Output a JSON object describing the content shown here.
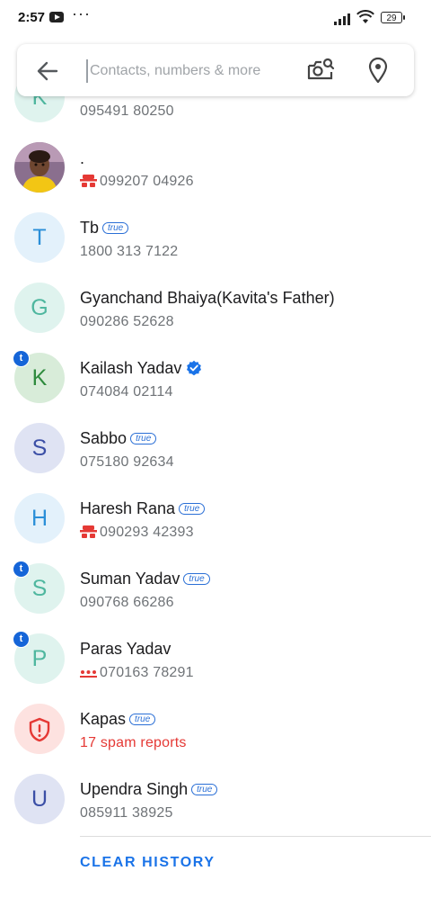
{
  "status_bar": {
    "time": "2:57",
    "battery": "29"
  },
  "search": {
    "placeholder": "Contacts, numbers & more"
  },
  "true_badge_text": "true",
  "contacts": [
    {
      "name": "",
      "number": "095491 80250",
      "avatar_letter": "K",
      "avatar_bg": "#dff3ee",
      "avatar_fg": "#4fb79f"
    },
    {
      "name": ".",
      "number": "099207 04926",
      "avatar_type": "photo",
      "number_icon": "spy-icon"
    },
    {
      "name": "Tb",
      "number": "1800 313 7122",
      "avatar_letter": "T",
      "avatar_bg": "#e3f1fb",
      "avatar_fg": "#2b8fd8",
      "true_badge": true
    },
    {
      "name": "Gyanchand Bhaiya(Kavita's Father)",
      "number": "090286 52628",
      "avatar_letter": "G",
      "avatar_bg": "#dff3ee",
      "avatar_fg": "#4fb79f"
    },
    {
      "name": "Kailash Yadav",
      "number": "074084 02114",
      "avatar_letter": "K",
      "avatar_bg": "#d8ecd9",
      "avatar_fg": "#2e8b3d",
      "verified": true,
      "truecaller_badge": true
    },
    {
      "name": "Sabbo",
      "number": "075180 92634",
      "avatar_letter": "S",
      "avatar_bg": "#dfe3f3",
      "avatar_fg": "#3b4fa6",
      "true_badge": true
    },
    {
      "name": "Haresh Rana",
      "number": "090293 42393",
      "avatar_letter": "H",
      "avatar_bg": "#e3f1fb",
      "avatar_fg": "#2b8fd8",
      "true_badge": true,
      "number_icon": "spy-icon"
    },
    {
      "name": "Suman Yadav",
      "number": "090768 66286",
      "avatar_letter": "S",
      "avatar_bg": "#dff3ee",
      "avatar_fg": "#4fb79f",
      "true_badge": true,
      "truecaller_badge": true
    },
    {
      "name": "Paras Yadav",
      "number": "070163 78291",
      "avatar_letter": "P",
      "avatar_bg": "#dff3ee",
      "avatar_fg": "#4fb79f",
      "truecaller_badge": true,
      "number_icon": "dots-icon"
    },
    {
      "name": "Kapas",
      "number": "17 spam reports",
      "avatar_type": "spam",
      "avatar_bg": "#fde2e0",
      "avatar_fg": "#e53935",
      "true_badge": true,
      "spam": true
    },
    {
      "name": "Upendra Singh",
      "number": "085911 38925",
      "avatar_letter": "U",
      "avatar_bg": "#dfe3f3",
      "avatar_fg": "#3b4fa6",
      "true_badge": true
    }
  ],
  "footer": {
    "clear_history_label": "CLEAR HISTORY"
  },
  "colors": {
    "accent": "#1a73e8",
    "spam": "#e53935",
    "truecaller_blue": "#1565d8"
  }
}
